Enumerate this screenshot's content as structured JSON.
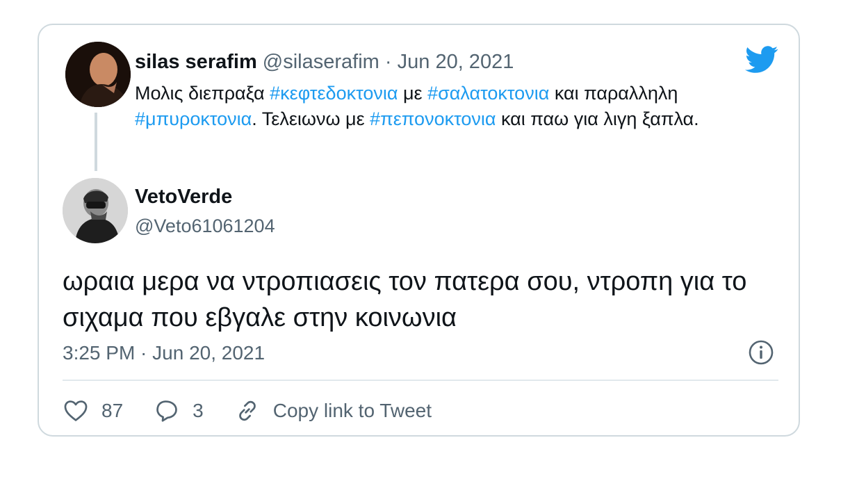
{
  "parent_tweet": {
    "display_name": "silas serafim",
    "handle": "@silaserafim",
    "separator": "·",
    "date": "Jun 20, 2021",
    "text_segments": [
      {
        "text": "Μολις διεπραξα ",
        "tag": false
      },
      {
        "text": "#κεφτεδοκτονια",
        "tag": true
      },
      {
        "text": " με ",
        "tag": false
      },
      {
        "text": "#σαλατοκτονια",
        "tag": true
      },
      {
        "text": " και παραλληλη ",
        "tag": false
      },
      {
        "text": "#μπυροκτονια",
        "tag": true
      },
      {
        "text": ". Τελειωνω με ",
        "tag": false
      },
      {
        "text": "#πεπονοκτονια",
        "tag": true
      },
      {
        "text": " και παω για λιγη ξαπλα.",
        "tag": false
      }
    ]
  },
  "reply_tweet": {
    "display_name": "VetoVerde",
    "handle": "@Veto61061204",
    "text": "ωραια μερα να ντροπιασεις τον πατερα σου, ντροπη για το σιχαμα που εβγαλε στην κοινωνια",
    "timestamp": "3:25 PM · Jun 20, 2021"
  },
  "actions": {
    "likes": "87",
    "replies": "3",
    "copy_link_label": "Copy link to Tweet"
  },
  "colors": {
    "accent": "#1d9bf0",
    "muted": "#536471",
    "border": "#cfd9de"
  },
  "icons": [
    "twitter-bird-icon",
    "info-icon",
    "heart-icon",
    "reply-icon",
    "link-icon"
  ]
}
